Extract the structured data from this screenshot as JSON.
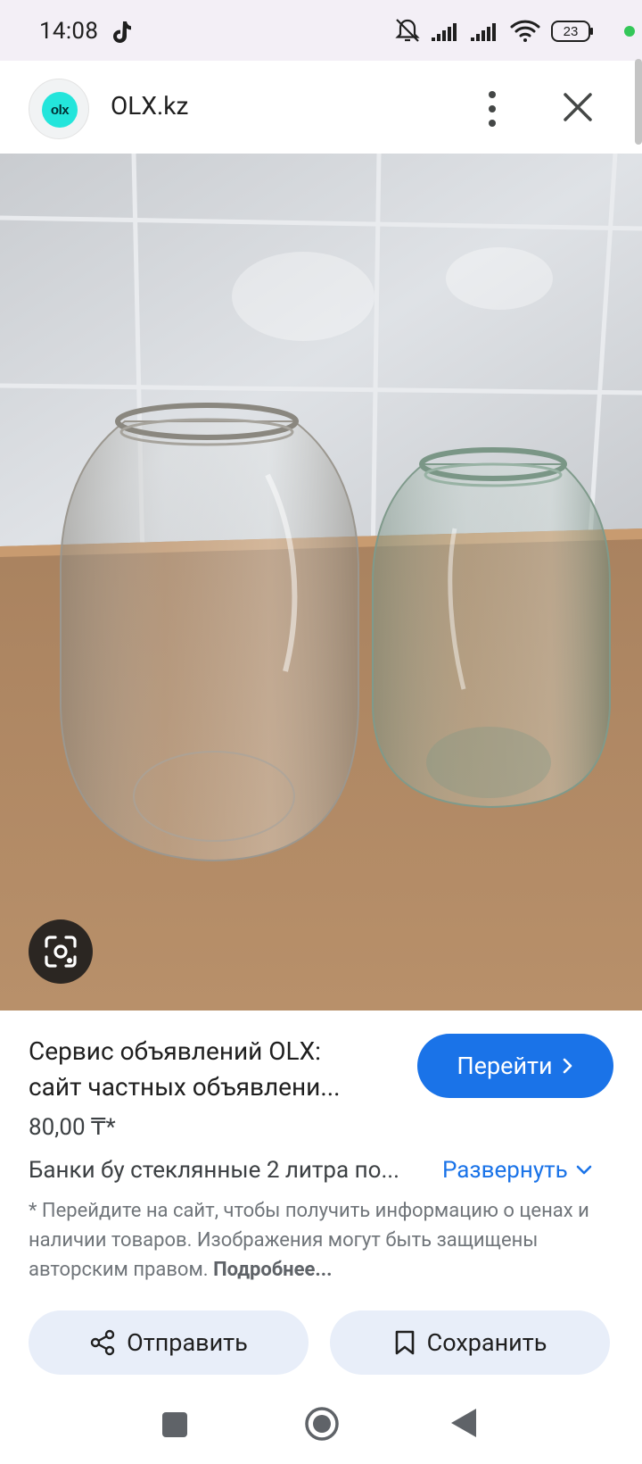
{
  "status_bar": {
    "time": "14:08",
    "battery_level": "23",
    "icons": [
      "tiktok-icon",
      "bell-off-icon",
      "signal-icon",
      "signal-icon",
      "wifi-icon",
      "battery-icon",
      "dot-indicator"
    ]
  },
  "header": {
    "site_name": "OLX.kz",
    "logo_text": "olx"
  },
  "result": {
    "title_line1": "Сервис объявлений OLX:",
    "title_line2": "сайт частных объявлени...",
    "go_button_label": "Перейти",
    "price": "80,00 ₸*",
    "description": "Банки бу стеклянные 2 литра по...",
    "expand_label": "Развернуть",
    "disclaimer": "* Перейдите на сайт, чтобы получить информацию о ценах и наличии товаров. Изображения могут быть защищены авторским правом.",
    "more_link": "Подробнее..."
  },
  "actions": {
    "share_label": "Отправить",
    "save_label": "Сохранить"
  },
  "colors": {
    "accent": "#1a73e8",
    "button_bg": "#e8eef9",
    "status_bg": "#f3eff6",
    "olx_teal": "#23e5db"
  }
}
